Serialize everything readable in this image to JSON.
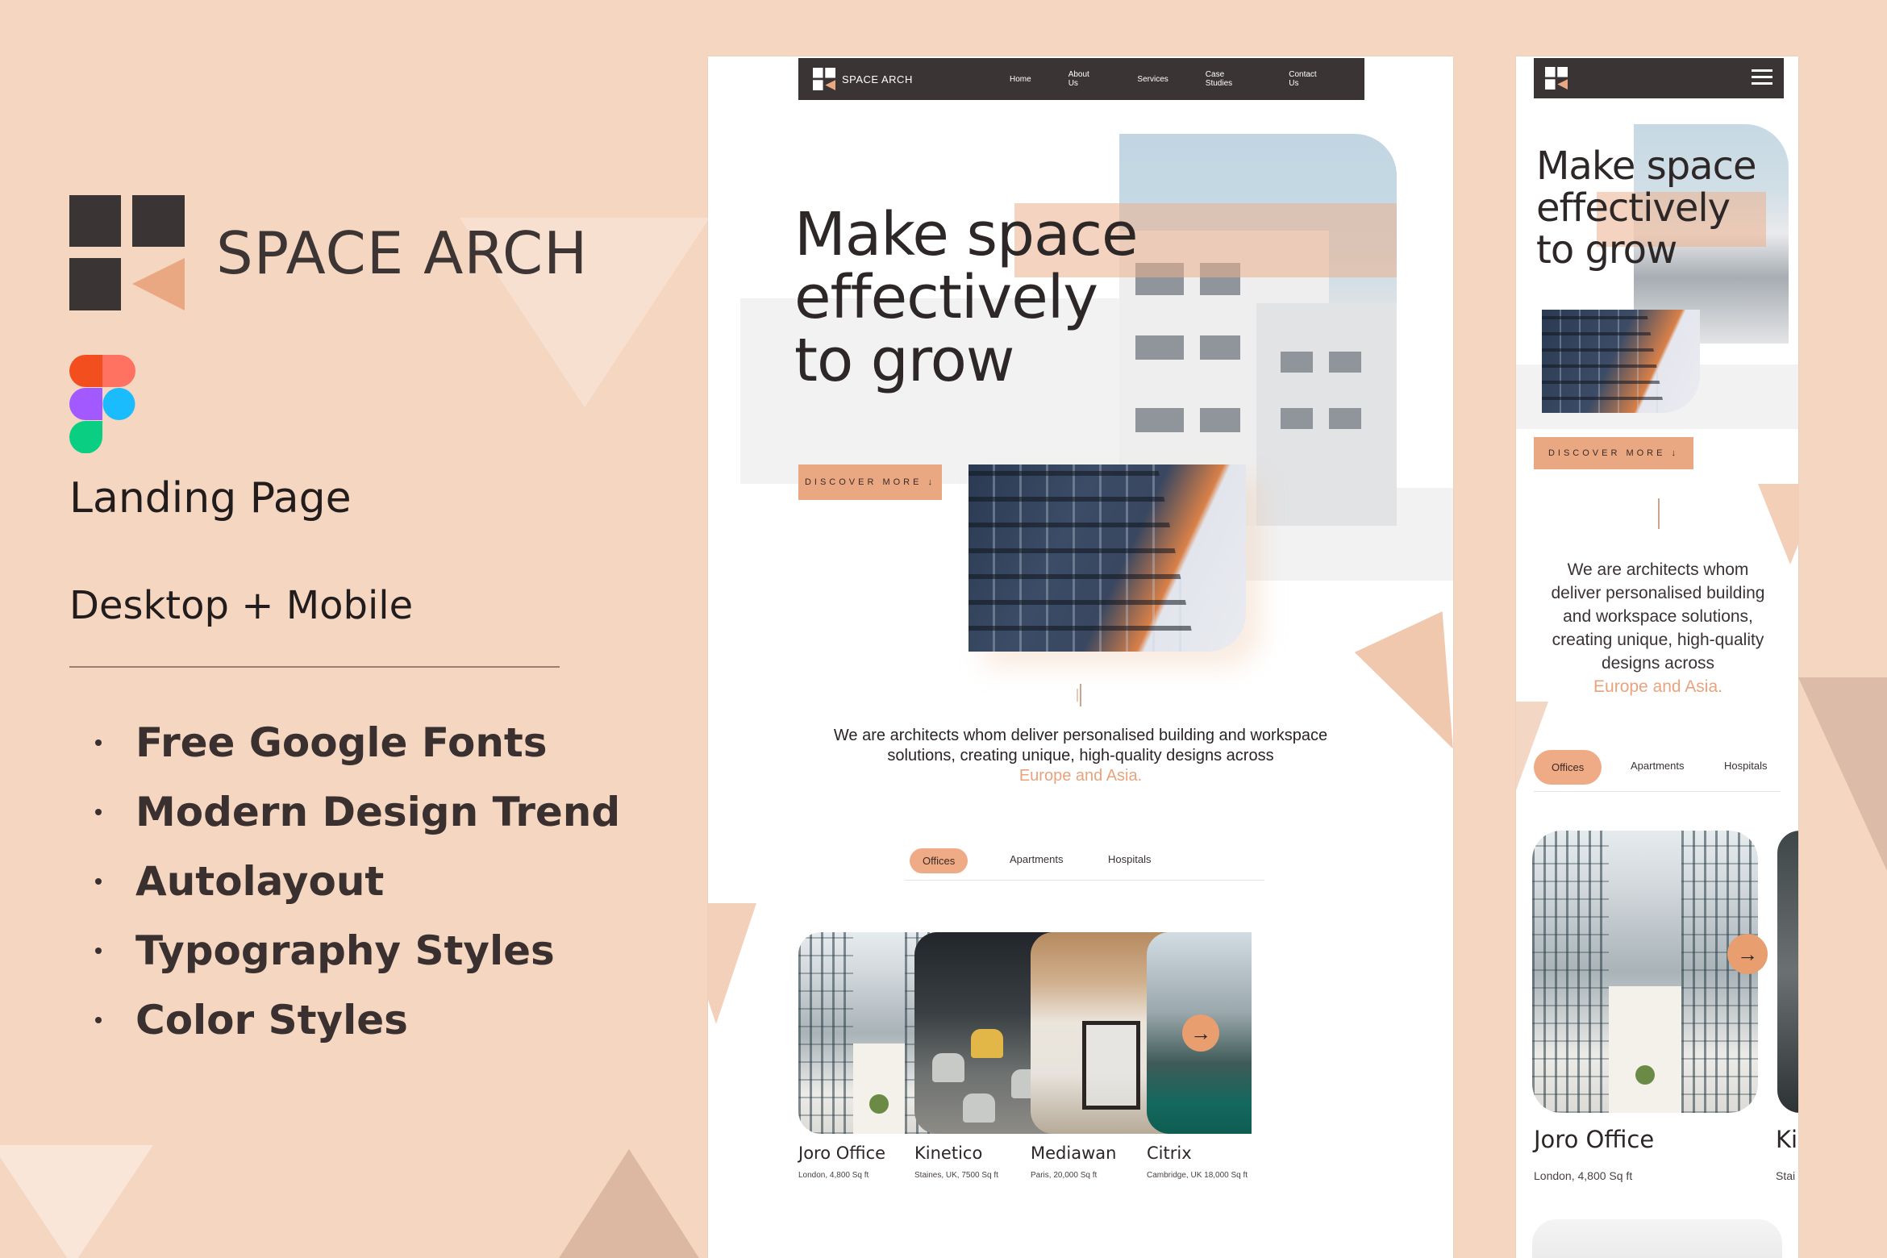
{
  "brand": {
    "name": "SPACE ARCH",
    "colors": {
      "accent": "#e9a782",
      "dark": "#3a3434",
      "background": "#f5d6c0"
    }
  },
  "left_panel": {
    "figma_icon": "figma-logo-icon",
    "title": "Landing Page",
    "subtitle": "Desktop + Mobile",
    "features": [
      "Free Google Fonts",
      "Modern Design Trend",
      "Autolayout",
      "Typography Styles",
      "Color Styles"
    ]
  },
  "desktop": {
    "nav": {
      "brand": "SPACE ARCH",
      "links": [
        "Home",
        "About Us",
        "Services",
        "Case Studies",
        "Contact Us"
      ]
    },
    "hero": {
      "line1": "Make space",
      "line2": "effectively",
      "line3": "to grow",
      "cta": "DISCOVER MORE ↓"
    },
    "description": {
      "text": "We are architects whom deliver personalised building and workspace solutions, creating unique, high-quality designs across",
      "accent": "Europe and Asia."
    },
    "tabs": [
      "Offices",
      "Apartments",
      "Hospitals"
    ],
    "active_tab": "Offices",
    "projects": [
      {
        "name": "Joro Office",
        "meta": "London, 4,800 Sq ft"
      },
      {
        "name": "Kinetico",
        "meta": "Staines, UK, 7500 Sq ft"
      },
      {
        "name": "Mediawan",
        "meta": "Paris, 20,000 Sq ft"
      },
      {
        "name": "Citrix",
        "meta": "Cambridge, UK 18,000 Sq ft"
      }
    ],
    "next_icon": "arrow-right-icon"
  },
  "mobile": {
    "menu_icon": "hamburger-menu-icon",
    "hero": {
      "line1": "Make space",
      "line2": "effectively",
      "line3": "to grow",
      "cta": "DISCOVER MORE ↓"
    },
    "description": {
      "text": "We are architects whom deliver personalised building and workspace solutions, creating unique, high-quality designs across",
      "accent": "Europe and Asia."
    },
    "tabs": [
      "Offices",
      "Apartments",
      "Hospitals"
    ],
    "projects": [
      {
        "name": "Joro Office",
        "meta": "London, 4,800 Sq ft"
      },
      {
        "name": "Ki",
        "meta": "Stai"
      }
    ]
  }
}
